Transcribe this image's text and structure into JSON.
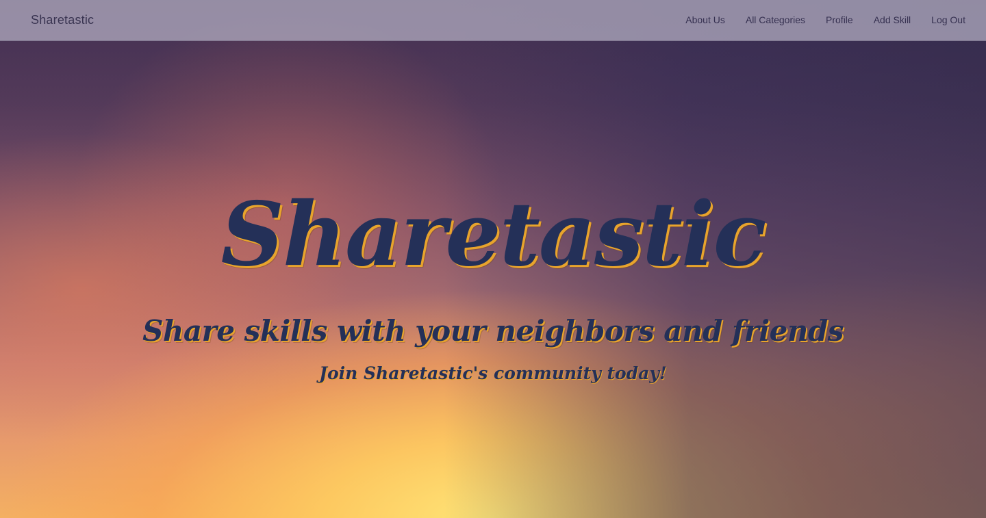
{
  "navbar": {
    "brand": "Sharetastic",
    "links": [
      {
        "label": "About Us"
      },
      {
        "label": "All Categories"
      },
      {
        "label": "Profile"
      },
      {
        "label": "Add Skill"
      },
      {
        "label": "Log Out"
      }
    ]
  },
  "hero": {
    "title": "Sharetastic",
    "subtitle": "Share skills with your neighbors and friends",
    "tagline": "Join Sharetastic's community today!",
    "background": "sunset-sky-image"
  },
  "colors": {
    "title_text": "#243058",
    "title_outline": "#e8a42c",
    "navbar_bg": "#b2acc0"
  }
}
